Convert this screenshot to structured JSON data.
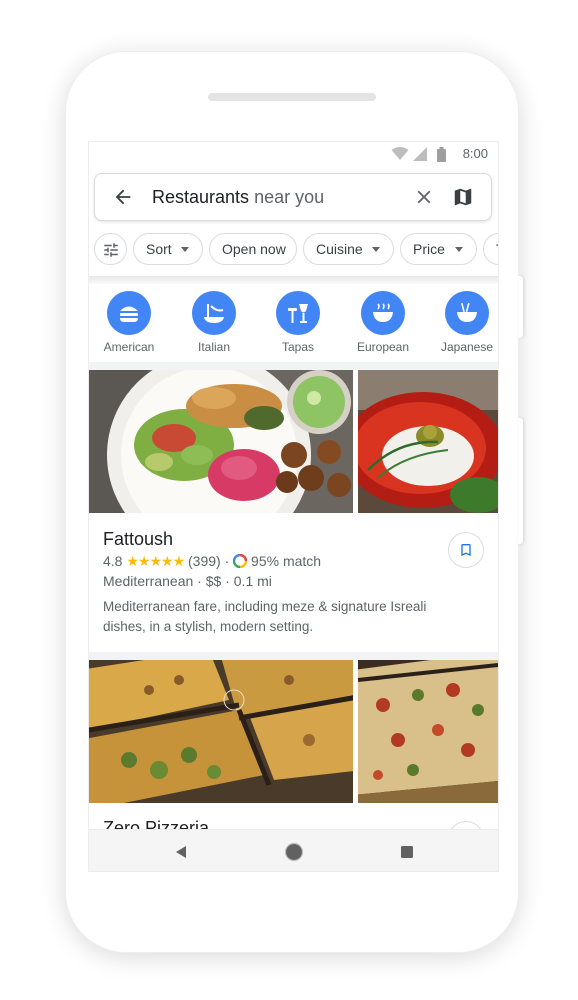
{
  "status_bar": {
    "time": "8:00",
    "icons": [
      "wifi-icon",
      "signal-icon",
      "battery-icon"
    ]
  },
  "search": {
    "back_icon": "arrow-back-icon",
    "query_bold": "Restaurants",
    "query_rest": " near you",
    "clear_icon": "close-icon",
    "map_icon": "map-icon"
  },
  "filters": {
    "filter_icon": "tune-icon",
    "chips": [
      {
        "label": "Sort",
        "has_caret": true
      },
      {
        "label": "Open now",
        "has_caret": false
      },
      {
        "label": "Cuisine",
        "has_caret": true
      },
      {
        "label": "Price",
        "has_caret": true
      },
      {
        "label": "T",
        "has_caret": false
      }
    ]
  },
  "categories": [
    {
      "label": "American",
      "icon": "burger-icon"
    },
    {
      "label": "Italian",
      "icon": "pasta-icon"
    },
    {
      "label": "Tapas",
      "icon": "tapas-icon"
    },
    {
      "label": "European",
      "icon": "bowl-icon"
    },
    {
      "label": "Japanese",
      "icon": "ramen-icon"
    }
  ],
  "results": [
    {
      "name": "Fattoush",
      "rating": "4.8",
      "stars": "★★★★★",
      "reviews": "(399)",
      "match": "95% match",
      "cuisine": "Mediterranean",
      "price": "$$",
      "distance": "0.1 mi",
      "description": "Mediterranean fare, including meze & signature Isreali dishes, in a stylish, modern setting.",
      "save_icon": "bookmark-icon"
    },
    {
      "name": "Zero Pizzeria",
      "save_icon": "bookmark-icon"
    }
  ],
  "colors": {
    "accent": "#4285f4",
    "star": "#fbbc04",
    "text": "#202124",
    "secondary": "#5f6368"
  }
}
